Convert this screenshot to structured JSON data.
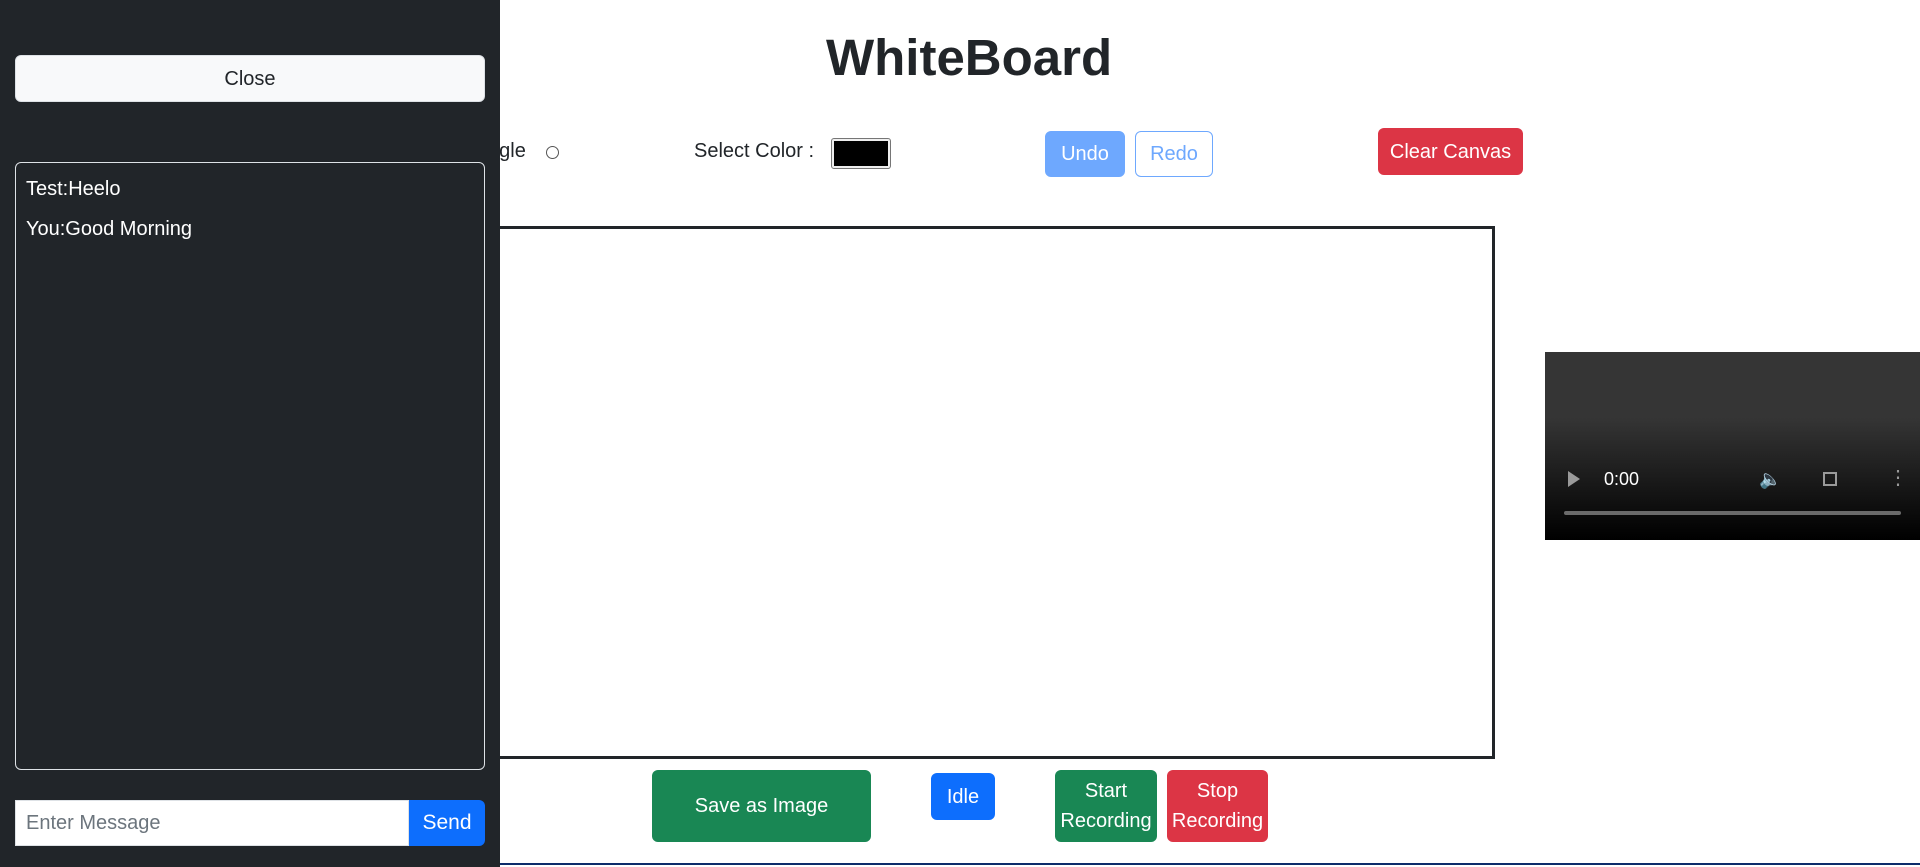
{
  "header": {
    "title": "WhiteBoard"
  },
  "toolbar": {
    "shape_option_partial": "ngle",
    "select_color_label": "Select Color :",
    "selected_color": "#000000",
    "undo_label": "Undo",
    "redo_label": "Redo",
    "clear_label": "Clear Canvas"
  },
  "actions": {
    "save_label": "Save as Image",
    "status_label": "Idle",
    "start_recording_line1": "Start",
    "start_recording_line2": "Recording",
    "stop_recording_line1": "Stop",
    "stop_recording_line2": "Recording"
  },
  "video": {
    "time": "0:00"
  },
  "sidebar": {
    "close_label": "Close",
    "messages": [
      {
        "text": "Test:Heelo"
      },
      {
        "text": "You:Good Morning"
      }
    ],
    "input": {
      "placeholder": "Enter Message",
      "value": ""
    },
    "send_label": "Send"
  },
  "colors": {
    "sidebar_bg": "#212529",
    "primary": "#0d6efd",
    "primary_faded": "#6ea8fe",
    "success": "#198754",
    "danger": "#dc3545"
  }
}
